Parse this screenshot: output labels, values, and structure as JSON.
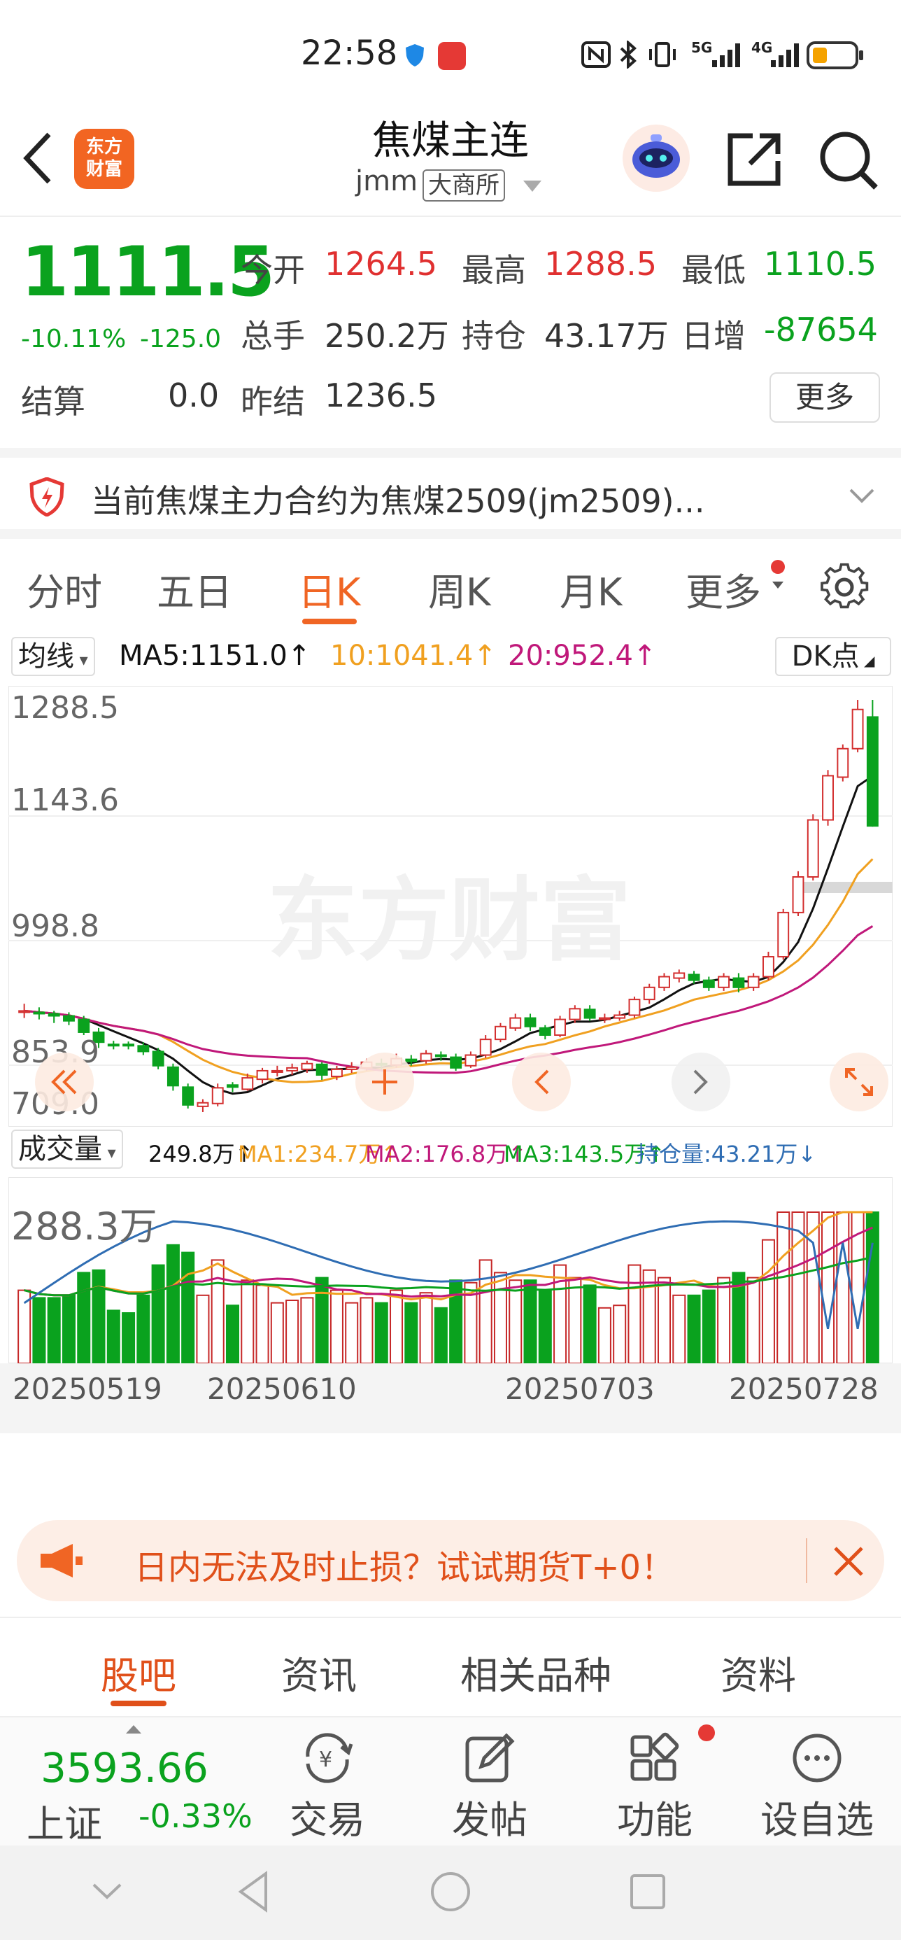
{
  "status": {
    "time": "22:58",
    "sim1": "5G",
    "sim2": "4G"
  },
  "header": {
    "title": "焦煤主连",
    "code": "jmm",
    "exchange": "大商所",
    "logo_line1": "东方",
    "logo_line2": "财富"
  },
  "quote": {
    "price": "1111.5",
    "pct": "-10.11%",
    "change": "-125.0",
    "open_label": "今开",
    "open": "1264.5",
    "high_label": "最高",
    "high": "1288.5",
    "low_label": "最低",
    "low": "1110.5",
    "vol_label": "总手",
    "vol": "250.2万",
    "oi_label": "持仓",
    "oi": "43.17万",
    "oi_chg_label": "日增",
    "oi_chg": "-87654",
    "settle_label": "结算",
    "settle": "0.0",
    "prev_settle_label": "昨结",
    "prev_settle": "1236.5",
    "more_label": "更多"
  },
  "notice": {
    "text": "当前焦煤主力合约为焦煤2509(jm2509)..."
  },
  "tabs": [
    "分时",
    "五日",
    "日K",
    "周K",
    "月K",
    "更多"
  ],
  "chart": {
    "ma_selector": "均线",
    "ma5": "MA5:1151.0↑",
    "ma10": "10:1041.4↑",
    "ma20": "20:952.4↑",
    "dk_button": "DK点",
    "price_ticks": [
      "1288.5",
      "1143.6",
      "998.8",
      "853.9",
      "709.0"
    ],
    "watermark": "东方财富",
    "vol_selector": "成交量",
    "vol_val": "249.8万↑",
    "vma1": "MA1:234.7万↑",
    "vma2": "MA2:176.8万↑",
    "vma3": "MA3:143.5万↑",
    "oi_val": "持仓量:43.21万↓",
    "vol_tick": "288.3万",
    "dates": [
      "20250519",
      "20250610",
      "20250703",
      "20250728"
    ]
  },
  "chart_data": {
    "type": "candlestick",
    "ylim": [
      709.0,
      1288.5
    ],
    "candles": [
      [
        850,
        852,
        862,
        842
      ],
      [
        850,
        848,
        857,
        840
      ],
      [
        848,
        845,
        852,
        835
      ],
      [
        845,
        838,
        850,
        832
      ],
      [
        840,
        822,
        845,
        818
      ],
      [
        822,
        808,
        828,
        800
      ],
      [
        805,
        804,
        810,
        798
      ],
      [
        805,
        803,
        809,
        798
      ],
      [
        803,
        795,
        808,
        790
      ],
      [
        795,
        775,
        800,
        770
      ],
      [
        773,
        747,
        778,
        740
      ],
      [
        745,
        720,
        750,
        715
      ],
      [
        718,
        723,
        728,
        710
      ],
      [
        722,
        744,
        750,
        718
      ],
      [
        748,
        745,
        752,
        738
      ],
      [
        742,
        758,
        764,
        740
      ],
      [
        756,
        768,
        772,
        750
      ],
      [
        766,
        768,
        775,
        760
      ],
      [
        768,
        772,
        778,
        762
      ],
      [
        770,
        778,
        782,
        765
      ],
      [
        777,
        762,
        780,
        755
      ],
      [
        760,
        770,
        775,
        755
      ],
      [
        770,
        773,
        780,
        765
      ],
      [
        772,
        780,
        785,
        768
      ],
      [
        778,
        776,
        785,
        770
      ],
      [
        776,
        785,
        792,
        772
      ],
      [
        784,
        781,
        790,
        775
      ],
      [
        782,
        792,
        797,
        778
      ],
      [
        790,
        788,
        795,
        782
      ],
      [
        787,
        772,
        792,
        768
      ],
      [
        775,
        790,
        795,
        772
      ],
      [
        790,
        812,
        818,
        786
      ],
      [
        812,
        830,
        835,
        808
      ],
      [
        828,
        842,
        848,
        824
      ],
      [
        842,
        830,
        848,
        824
      ],
      [
        828,
        818,
        832,
        812
      ],
      [
        818,
        840,
        845,
        815
      ],
      [
        840,
        855,
        860,
        835
      ],
      [
        854,
        842,
        860,
        838
      ],
      [
        840,
        842,
        848,
        835
      ],
      [
        842,
        846,
        852,
        838
      ],
      [
        846,
        868,
        872,
        842
      ],
      [
        868,
        885,
        890,
        862
      ],
      [
        885,
        900,
        905,
        880
      ],
      [
        898,
        905,
        910,
        892
      ],
      [
        903,
        895,
        908,
        890
      ],
      [
        895,
        885,
        900,
        880
      ],
      [
        885,
        900,
        905,
        880
      ],
      [
        898,
        885,
        905,
        878
      ],
      [
        885,
        900,
        905,
        880
      ],
      [
        900,
        928,
        935,
        895
      ],
      [
        928,
        990,
        995,
        924
      ],
      [
        990,
        1040,
        1048,
        985
      ],
      [
        1040,
        1120,
        1128,
        1035
      ],
      [
        1120,
        1182,
        1190,
        1112
      ],
      [
        1180,
        1220,
        1226,
        1174
      ],
      [
        1220,
        1275,
        1288.5,
        1215
      ],
      [
        1264.5,
        1111.5,
        1288.5,
        1110.5
      ]
    ],
    "ma_lines": [
      {
        "name": "MA5",
        "value": 1151.0,
        "color": "#111111"
      },
      {
        "name": "MA10",
        "value": 1041.4,
        "color": "#f0a020"
      },
      {
        "name": "MA20",
        "value": 952.4,
        "color": "#c0187a"
      }
    ],
    "volume_last": "249.8万",
    "volume_max": "288.3万",
    "open_interest": "43.21万",
    "x_tick_labels": [
      "20250519",
      "20250610",
      "20250703",
      "20250728"
    ]
  },
  "banner": {
    "text": "日内无法及时止损？试试期货T+0！"
  },
  "subtabs": [
    "股吧",
    "资讯",
    "相关品种",
    "资料"
  ],
  "bottom": {
    "index_value": "3593.66",
    "index_name": "上证",
    "index_pct": "-0.33%",
    "trade": "交易",
    "post": "发帖",
    "func": "功能",
    "watch": "设自选"
  }
}
